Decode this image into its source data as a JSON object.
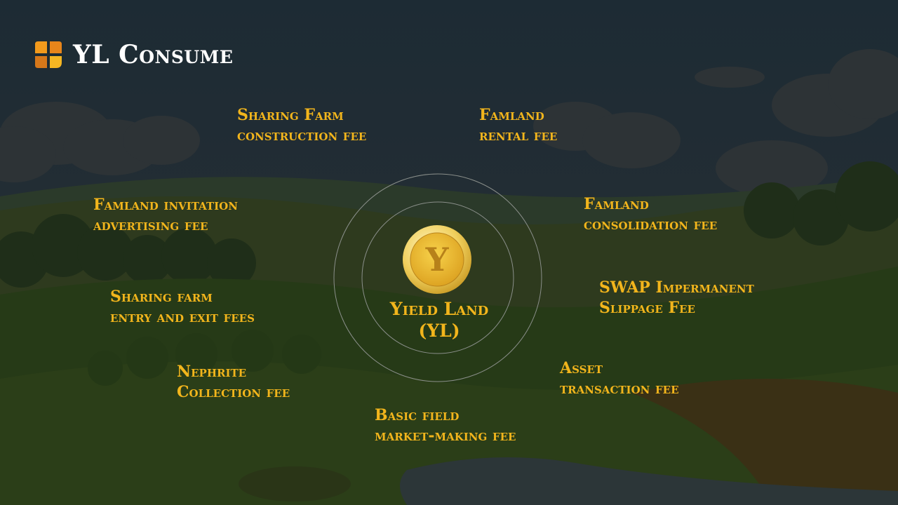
{
  "header": {
    "title": "YL Consume"
  },
  "center": {
    "name": "Yield Land",
    "ticker": "(YL)",
    "coin_letter": "Y"
  },
  "fees": [
    {
      "line1": "Sharing Farm",
      "line2": "construction fee"
    },
    {
      "line1": "Famland",
      "line2": "rental fee"
    },
    {
      "line1": "Famland invitation",
      "line2": "advertising fee"
    },
    {
      "line1": "Famland",
      "line2": "consolidation fee"
    },
    {
      "line1": "Sharing farm",
      "line2": "entry and exit fees"
    },
    {
      "line1": "SWAP Impermanent",
      "line2": "Slippage Fee"
    },
    {
      "line1": "Nephrite",
      "line2": "Collection fee"
    },
    {
      "line1": "Asset",
      "line2": "transaction fee"
    },
    {
      "line1": "Basic field",
      "line2": "market-making fee"
    }
  ],
  "colors": {
    "accent": "#f2b51c",
    "title": "#ffffff",
    "background": "#1e2b33"
  }
}
